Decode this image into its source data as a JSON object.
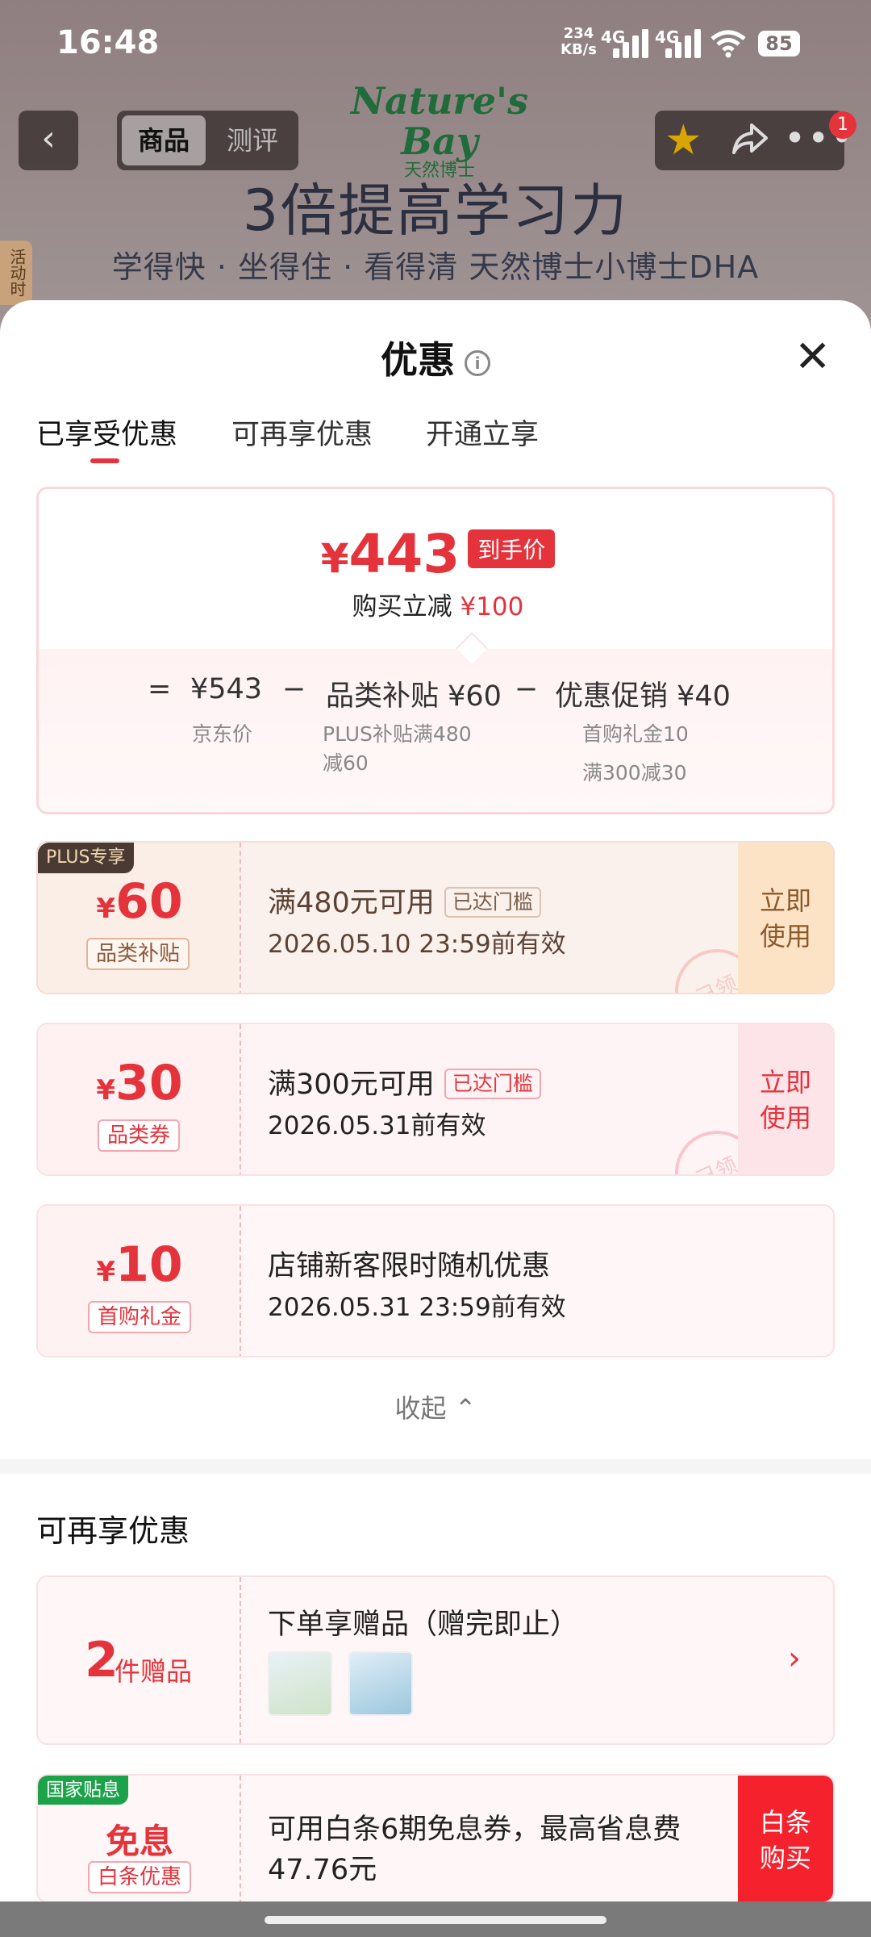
{
  "status_bar": {
    "time": "16:48",
    "net_speed_top": "234",
    "net_speed_unit": "KB/s",
    "sim1": "4G",
    "sim2": "4G",
    "battery": "85"
  },
  "header": {
    "back_icon": "chevron-left-icon",
    "tab_product": "商品",
    "tab_review": "测评",
    "notification_count": "1"
  },
  "banner": {
    "logo_text": "Nature's Bay",
    "logo_sub": "天然博士",
    "headline": "3倍提高学习力",
    "subline": "学得快 · 坐得住 · 看得清 天然博士小博士DHA",
    "side_tab": "活动时"
  },
  "sheet": {
    "title": "优惠",
    "tabs": [
      {
        "label": "已享受优惠"
      },
      {
        "label": "可再享优惠"
      },
      {
        "label": "开通立享"
      }
    ],
    "summary": {
      "currency": "¥",
      "final_price": "443",
      "final_tag": "到手价",
      "reduce_label": "购买立减",
      "reduce_amount": "¥100",
      "eq": "=",
      "base_price": "¥543",
      "base_label": "京东价",
      "minus1": "−",
      "sub1_name": "品类补贴 ¥60",
      "sub1_line1": "PLUS补贴满480",
      "sub1_line2": "减60",
      "minus2": "−",
      "sub2_name": "优惠促销 ¥40",
      "sub2_line1": "首购礼金10",
      "sub2_line2": "满300减30"
    },
    "coupons": [
      {
        "badge": "PLUS专享",
        "currency": "¥",
        "amount": "60",
        "label": "品类补贴",
        "title": "满480元可用",
        "condition": "已达门槛",
        "validity": "2026.05.10 23:59前有效",
        "action_line1": "立即",
        "action_line2": "使用",
        "stamp": "已领"
      },
      {
        "currency": "¥",
        "amount": "30",
        "label": "品类券",
        "title": "满300元可用",
        "condition": "已达门槛",
        "validity": "2026.05.31前有效",
        "action_line1": "立即",
        "action_line2": "使用",
        "stamp": "已领"
      },
      {
        "currency": "¥",
        "amount": "10",
        "label": "首购礼金",
        "title": "店铺新客限时随机优惠",
        "validity": "2026.05.31 23:59前有效"
      }
    ],
    "collapse_label": "收起",
    "more_section": {
      "title": "可再享优惠",
      "gift": {
        "count": "2",
        "unit": "件赠品",
        "title": "下单享赠品（赠完即止）"
      },
      "baitiao": {
        "badge": "国家贴息",
        "big": "免息",
        "label": "白条优惠",
        "text": "可用白条6期免息券，最高省息费47.76元",
        "action_line1": "白条",
        "action_line2": "购买"
      }
    }
  },
  "colors": {
    "accent": "#e5333c",
    "plus_bg": "#fbeee6",
    "plus_action": "#fde3c6",
    "green_badge": "#1ca34a"
  }
}
